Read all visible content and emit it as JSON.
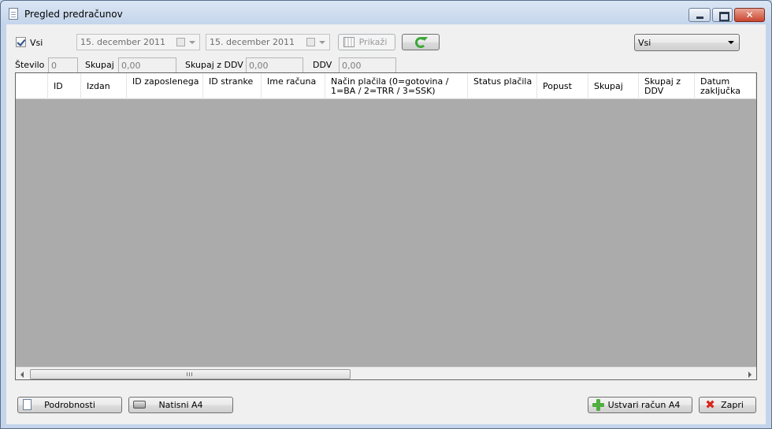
{
  "window": {
    "title": "Pregled predračunov"
  },
  "filters": {
    "all_label": "Vsi",
    "all_checked": true,
    "date_from": "15. december 2011",
    "date_to": "15. december 2011",
    "show_label": "Prikaži",
    "type_selected": "Vsi"
  },
  "totals": {
    "count_label": "Število",
    "count_value": "0",
    "sum_label": "Skupaj",
    "sum_value": "0,00",
    "sum_vat_label": "Skupaj z DDV",
    "sum_vat_value": "0,00",
    "vat_label": "DDV",
    "vat_value": "0,00"
  },
  "grid": {
    "columns": [
      "ID",
      "Izdan",
      "ID zaposlenega",
      "ID stranke",
      "Ime računa",
      "Način plačila (0=gotovina / 1=BA / 2=TRR / 3=SSK)",
      "Status plačila",
      "Popust",
      "Skupaj",
      "Skupaj z DDV",
      "Datum zaključka"
    ],
    "rows": []
  },
  "actions": {
    "details": "Podrobnosti",
    "print": "Natisni A4",
    "create": "Ustvari račun A4",
    "close": "Zapri"
  },
  "icons": [
    "document-icon",
    "calendar-icon",
    "refresh-icon",
    "printer-icon",
    "plus-icon",
    "close-x-icon"
  ],
  "colors": {
    "grid_background": "#ababab",
    "window_frame": "#c4d5eb",
    "refresh_green": "#3da63a",
    "close_red": "#d9261c"
  }
}
